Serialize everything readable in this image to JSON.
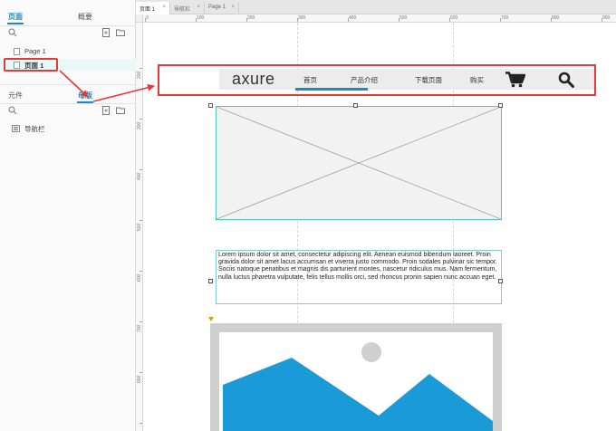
{
  "left_panel": {
    "pages_tab": "页面",
    "outline_tab": "概要",
    "pages": [
      {
        "label": "Page 1"
      },
      {
        "label": "页面 1"
      }
    ],
    "widgets_tab": "元件",
    "masters_tab": "母版",
    "masters": [
      {
        "label": "导航栏"
      }
    ]
  },
  "doc_tabs": [
    {
      "label": "页面 1",
      "active": true
    },
    {
      "label": "导航栏",
      "active": false
    },
    {
      "label": "Page 1",
      "active": false
    }
  ],
  "ruler": {
    "h_labels": [
      "0",
      "100",
      "200",
      "300",
      "400",
      "500",
      "600",
      "700",
      "800",
      "900"
    ],
    "v_labels": [
      "200",
      "300",
      "400",
      "500",
      "600",
      "700",
      "800"
    ]
  },
  "navbar": {
    "logo": "axure",
    "items": [
      "首页",
      "产品介绍",
      "下载页面",
      "购买"
    ],
    "cart_icon": "cart-icon",
    "search_icon": "search-icon"
  },
  "paragraph": {
    "text": "Lorem ipsum dolor sit amet, consectetur adipiscing elit. Aenean euismod bibendum laoreet. Proin gravida dolor sit amet lacus accumsan et viverra justo commodo. Proin sodales pulvinar sic tempor. Sociis natoque penatibus et magnis dis parturient montes, nascetur ridiculus mus. Nam fermentum, nulla luctus pharetra vulputate, felis tellus mollis orci, sed rhoncus pronin sapien nunc accuan eget."
  },
  "colors": {
    "accent": "#1e88c8",
    "annotation": "#e53935",
    "image_blue": "#1a9ad6"
  }
}
